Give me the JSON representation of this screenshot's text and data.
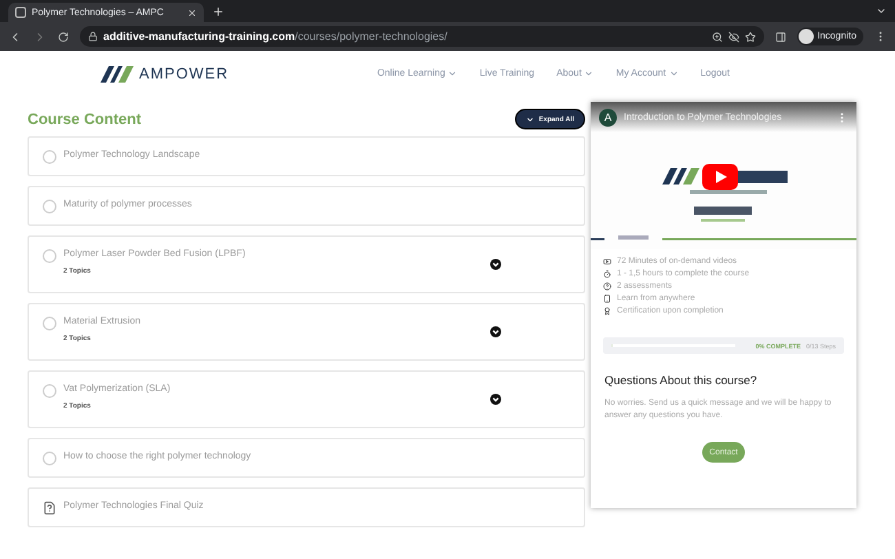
{
  "browser": {
    "tab": {
      "title": "Polymer Technologies – AMPC",
      "selected": true
    },
    "url": {
      "domain": "additive-manufacturing-training.com",
      "path": "/courses/polymer-technologies/"
    },
    "profile": "Incognito"
  },
  "site": {
    "logo": "AMPOWER",
    "nav": [
      {
        "label": "Online Learning",
        "dropdown": true
      },
      {
        "label": "Live Training",
        "dropdown": false
      },
      {
        "label": "About",
        "dropdown": true
      },
      {
        "label": "My Account",
        "dropdown": true
      },
      {
        "label": "Logout",
        "dropdown": false
      }
    ]
  },
  "course": {
    "title": "Course Content",
    "expand_button": "Expand All",
    "lessons": [
      {
        "kind": "lesson",
        "title": "Polymer Technology Landscape"
      },
      {
        "kind": "lesson",
        "title": "Maturity of polymer processes"
      },
      {
        "kind": "lesson",
        "title": "Polymer Laser Powder Bed Fusion (LPBF)",
        "topics": "2 Topics"
      },
      {
        "kind": "lesson",
        "title": "Material Extrusion",
        "topics": "2 Topics"
      },
      {
        "kind": "lesson",
        "title": "Vat Polymerization (SLA)",
        "topics": "2 Topics"
      },
      {
        "kind": "lesson",
        "title": "How to choose the right polymer technology"
      },
      {
        "kind": "quiz",
        "title": "Polymer Technologies Final Quiz"
      }
    ]
  },
  "sidebar": {
    "video": {
      "channel_initial": "A",
      "title": "Introduction to Polymer Technologies"
    },
    "features": [
      {
        "kind": "video",
        "text": "72 Minutes of on-demand videos"
      },
      {
        "kind": "timer",
        "text": "1 - 1,5 hours to complete the course"
      },
      {
        "kind": "question",
        "text": "2 assessments"
      },
      {
        "kind": "mobile",
        "text": "Learn from anywhere"
      },
      {
        "kind": "badge",
        "text": "Certification upon completion"
      }
    ],
    "progress": {
      "level": 0,
      "percent": "0% COMPLETE",
      "steps": "0/13 Steps"
    },
    "questions": {
      "heading": "Questions About this course?",
      "text": "No worries. Send us a quick message and we will be happy to answer any questions you have.",
      "button": "Contact"
    }
  }
}
